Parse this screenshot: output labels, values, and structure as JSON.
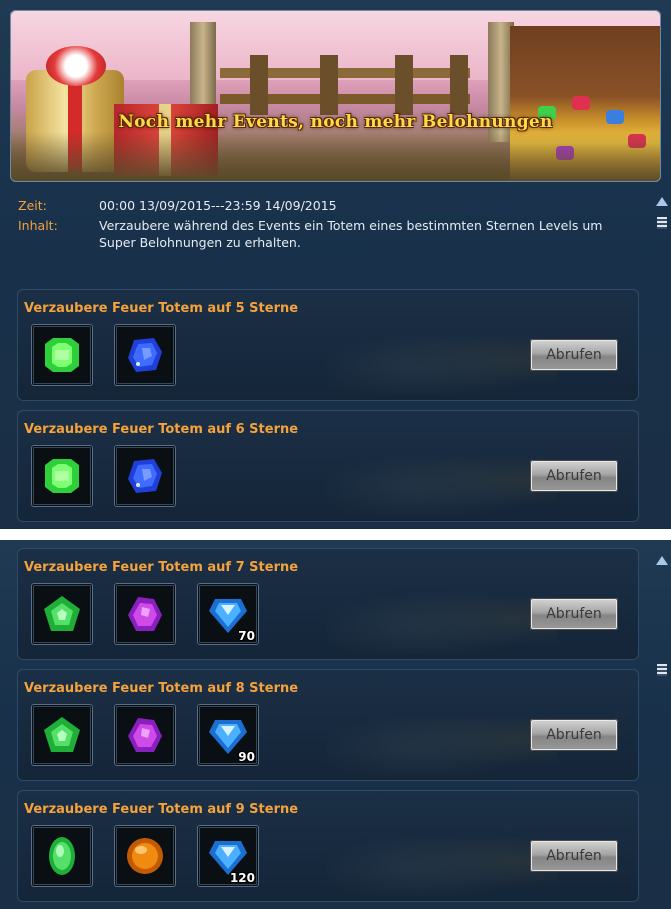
{
  "banner": {
    "title": "Noch mehr Events, noch mehr Belohnungen"
  },
  "info": {
    "time_label": "Zeit:",
    "time_value": "00:00 13/09/2015---23:59 14/09/2015",
    "content_label": "Inhalt:",
    "content_value": "Verzaubere während des Events ein Totem eines bestimmten Sternen Levels um Super Belohnungen zu erhalten."
  },
  "colors": {
    "accent_orange": "#f4a23c",
    "panel_bg": "#1a3046",
    "button_gray": "#a5a5a5"
  },
  "rewards_top": [
    {
      "title": "Verzaubere Feuer Totem auf 5 Sterne",
      "claim_label": "Abrufen",
      "items": [
        {
          "icon": "green-gem-icon",
          "count": ""
        },
        {
          "icon": "blue-crystal-icon",
          "count": ""
        }
      ]
    },
    {
      "title": "Verzaubere Feuer Totem auf 6 Sterne",
      "claim_label": "Abrufen",
      "items": [
        {
          "icon": "green-gem-icon",
          "count": ""
        },
        {
          "icon": "blue-crystal-icon",
          "count": ""
        }
      ]
    }
  ],
  "rewards_bottom": [
    {
      "title": "Verzaubere Feuer Totem auf 7 Sterne",
      "claim_label": "Abrufen",
      "items": [
        {
          "icon": "green-pentagon-gem-icon",
          "count": ""
        },
        {
          "icon": "purple-crystal-icon",
          "count": ""
        },
        {
          "icon": "blue-diamond-icon",
          "count": "70"
        }
      ]
    },
    {
      "title": "Verzaubere Feuer Totem auf 8 Sterne",
      "claim_label": "Abrufen",
      "items": [
        {
          "icon": "green-pentagon-gem-icon",
          "count": ""
        },
        {
          "icon": "purple-crystal-icon",
          "count": ""
        },
        {
          "icon": "blue-diamond-icon",
          "count": "90"
        }
      ]
    },
    {
      "title": "Verzaubere Feuer Totem auf 9 Sterne",
      "claim_label": "Abrufen",
      "items": [
        {
          "icon": "green-oval-gem-icon",
          "count": ""
        },
        {
          "icon": "orange-crystal-icon",
          "count": ""
        },
        {
          "icon": "blue-diamond-icon",
          "count": "120"
        }
      ]
    }
  ]
}
